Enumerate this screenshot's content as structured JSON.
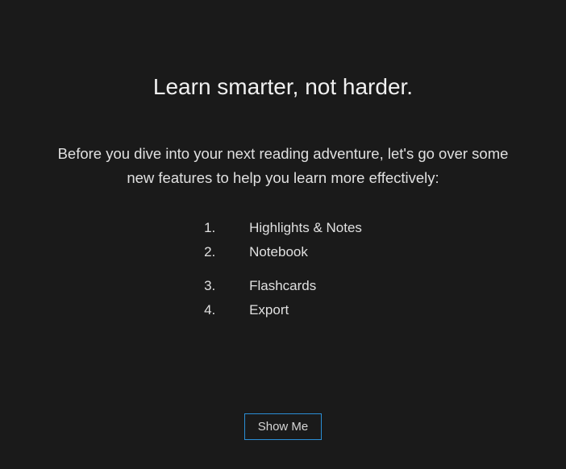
{
  "title": "Learn smarter, not harder.",
  "description": "Before you dive into your next reading adventure, let's go over some new features to help you learn more effectively:",
  "features": [
    {
      "num": "1.",
      "label": "Highlights & Notes"
    },
    {
      "num": "2.",
      "label": "Notebook"
    },
    {
      "num": "3.",
      "label": "Flashcards"
    },
    {
      "num": "4.",
      "label": "Export"
    }
  ],
  "button": {
    "show_me_label": "Show Me"
  }
}
